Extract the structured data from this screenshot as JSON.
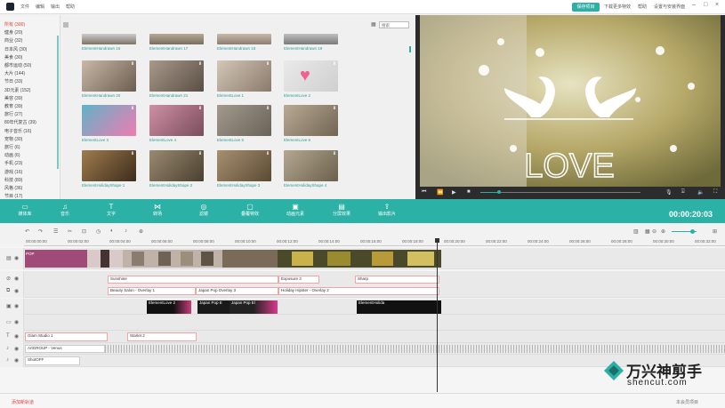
{
  "titlebar": {
    "menus": [
      "文件",
      "编辑",
      "输出",
      "帮助"
    ],
    "save_label": "保存项目",
    "right_items": [
      "下载更多特效",
      "帮助",
      "设置与安装界面"
    ]
  },
  "library": {
    "categories": [
      {
        "label": "所有 (300)",
        "selected": true
      },
      {
        "label": "健身 (20)"
      },
      {
        "label": "商业 (32)"
      },
      {
        "label": "日本风 (30)"
      },
      {
        "label": "美食 (30)"
      },
      {
        "label": "都市运动 (50)"
      },
      {
        "label": "大片 (144)"
      },
      {
        "label": "节日 (33)"
      },
      {
        "label": "3D元素 (152)"
      },
      {
        "label": "美容 (39)"
      },
      {
        "label": "教育 (39)"
      },
      {
        "label": "旅行 (27)"
      },
      {
        "label": "80年代复古 (39)"
      },
      {
        "label": "电子音乐 (16)"
      },
      {
        "label": "宠物 (30)"
      },
      {
        "label": "旅行 (6)"
      },
      {
        "label": "动画 (6)"
      },
      {
        "label": "手机 (23)"
      },
      {
        "label": "游戏 (16)"
      },
      {
        "label": "科技 (89)"
      },
      {
        "label": "风格 (36)"
      },
      {
        "label": "节目 (17)"
      }
    ],
    "search_placeholder": "搜索",
    "tiles": [
      {
        "label": "ElementHandrawn 16"
      },
      {
        "label": "ElementHandrawn 17"
      },
      {
        "label": "ElementHandrawn 18"
      },
      {
        "label": "ElementHandrawn 19"
      },
      {
        "label": "ElementHandrawn 20"
      },
      {
        "label": "ElementHandrawn 21"
      },
      {
        "label": "ElementLove 1"
      },
      {
        "label": "ElementLove 2"
      },
      {
        "label": "ElementLove 3"
      },
      {
        "label": "ElementLove 4"
      },
      {
        "label": "ElementLove 5"
      },
      {
        "label": "ElementLove 6"
      },
      {
        "label": "ElementHolidayShape 1"
      },
      {
        "label": "ElementHolidayShape 2"
      },
      {
        "label": "ElementHolidayShape 3"
      },
      {
        "label": "ElementHolidayShape 4"
      }
    ]
  },
  "preview": {
    "overlay_text": "LOVE"
  },
  "toolbar": {
    "tools": [
      "媒体库",
      "音乐",
      "文字",
      "转场",
      "滤镜",
      "叠覆特效",
      "动画元素",
      "分屏效果",
      "输出影片"
    ],
    "timecode": "00:00:20:03"
  },
  "timeline": {
    "ticks": [
      "00:00:00:00",
      "00:00:02:00",
      "00:00:04:00",
      "00:00:06:00",
      "00:00:08:00",
      "00:00:10:00",
      "00:00:12:00",
      "00:00:14:00",
      "00:00:16:00",
      "00:00:18:00",
      "00:00:20:00",
      "00:00:22:00",
      "00:00:24:00",
      "00:00:26:00",
      "00:00:28:00",
      "00:00:30:00",
      "00:00:32:00"
    ],
    "video_clip_label": "POP",
    "filter_clips": [
      "Sunshine",
      "Exposure 3",
      "Sharp"
    ],
    "overlay_clips": [
      "Beauty Salon - Overlay 1",
      "Japan Pop Overlay 3",
      "Holiday Hipster - Overlay 2"
    ],
    "element_clips": [
      "ElementLove 2",
      "Japan Pop E",
      "Japan Pop El",
      "ElementHolida"
    ],
    "text_clips": [
      "Glam Studio 1",
      "Starlet 2"
    ],
    "audio_clips": [
      "ArtGROUP - Venus",
      "ShotOFF"
    ],
    "status_left": "添加新轨道",
    "status_right": "本会员项目"
  },
  "watermark": {
    "text": "万兴神剪手",
    "url": "shencut.com"
  },
  "colors": {
    "accent": "#2bb1a5",
    "clip_border": "#f0a6a6",
    "alert": "#e04141"
  }
}
